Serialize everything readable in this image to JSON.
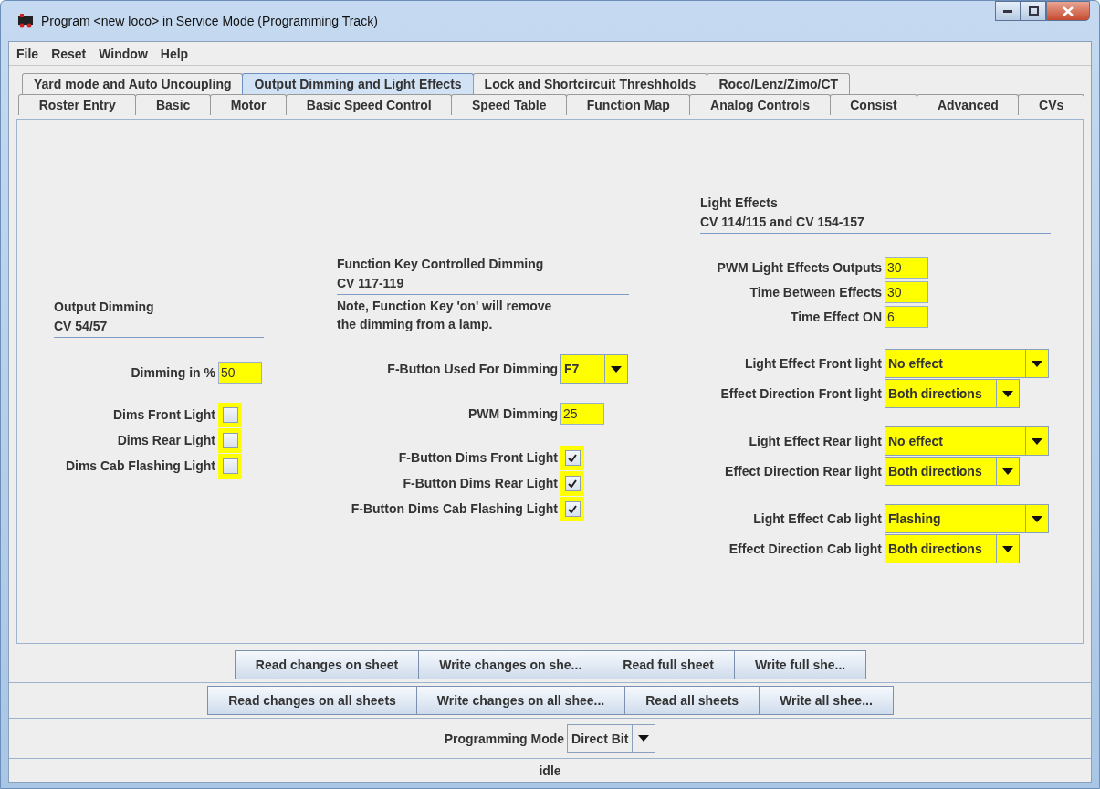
{
  "window": {
    "title": "Program <new loco> in Service Mode (Programming Track)"
  },
  "menu": [
    "File",
    "Reset",
    "Window",
    "Help"
  ],
  "tab_rows": [
    [
      {
        "label": "Yard mode and Auto Uncoupling",
        "selected": false
      },
      {
        "label": "Output Dimming and Light Effects",
        "selected": true
      },
      {
        "label": "Lock and Shortcircuit Threshholds",
        "selected": false
      },
      {
        "label": "Roco/Lenz/Zimo/CT",
        "selected": false
      }
    ],
    [
      {
        "label": "Roster Entry",
        "selected": false
      },
      {
        "label": "Basic",
        "selected": false
      },
      {
        "label": "Motor",
        "selected": false
      },
      {
        "label": "Basic Speed Control",
        "selected": false
      },
      {
        "label": "Speed Table",
        "selected": false
      },
      {
        "label": "Function Map",
        "selected": false
      },
      {
        "label": "Analog Controls",
        "selected": false
      },
      {
        "label": "Consist",
        "selected": false
      },
      {
        "label": "Advanced",
        "selected": false
      },
      {
        "label": "CVs",
        "selected": false
      }
    ]
  ],
  "sections": [
    {
      "title": "Output Dimming",
      "subtitle": "CV 54/57",
      "groups": [
        [
          {
            "kind": "field",
            "label": "Dimming in %",
            "value": "50"
          }
        ],
        [
          {
            "kind": "checkbox",
            "label": "Dims Front Light",
            "checked": false
          },
          {
            "kind": "checkbox",
            "label": "Dims Rear Light",
            "checked": false
          },
          {
            "kind": "checkbox",
            "label": "Dims Cab Flashing Light",
            "checked": false
          }
        ]
      ]
    },
    {
      "title": "Function Key Controlled Dimming",
      "subtitle": "CV 117-119",
      "note": [
        "Note, Function Key 'on' will remove",
        "the dimming from a lamp."
      ],
      "groups": [
        [
          {
            "kind": "dropdown",
            "label": "F-Button Used For Dimming",
            "value": "F7"
          }
        ],
        [
          {
            "kind": "field",
            "label": "PWM Dimming",
            "value": "25"
          }
        ],
        [
          {
            "kind": "checkbox",
            "label": "F-Button Dims Front Light",
            "checked": true
          },
          {
            "kind": "checkbox",
            "label": "F-Button Dims Rear Light",
            "checked": true
          },
          {
            "kind": "checkbox",
            "label": "F-Button Dims Cab Flashing Light",
            "checked": true
          }
        ]
      ]
    },
    {
      "title": "Light Effects",
      "subtitle": "CV 114/115 and CV 154-157",
      "groups": [
        [
          {
            "kind": "field",
            "label": "PWM Light Effects Outputs",
            "value": "30"
          },
          {
            "kind": "field",
            "label": "Time Between Effects",
            "value": "30"
          },
          {
            "kind": "field",
            "label": "Time Effect ON",
            "value": "6"
          }
        ],
        [
          {
            "kind": "dropdown",
            "label": "Light Effect Front light",
            "value": "No effect"
          },
          {
            "kind": "dropdown",
            "label": "Effect Direction Front light",
            "value": "Both directions"
          }
        ],
        [
          {
            "kind": "dropdown",
            "label": "Light Effect Rear light",
            "value": "No effect"
          },
          {
            "kind": "dropdown",
            "label": "Effect Direction Rear light",
            "value": "Both directions"
          }
        ],
        [
          {
            "kind": "dropdown",
            "label": "Light Effect Cab light",
            "value": "Flashing"
          },
          {
            "kind": "dropdown",
            "label": "Effect Direction Cab light",
            "value": "Both directions"
          }
        ]
      ]
    }
  ],
  "sheet_buttons": [
    "Read changes on sheet",
    "Write changes on she...",
    "Read full sheet",
    "Write full she..."
  ],
  "all_buttons": [
    "Read changes on all sheets",
    "Write changes on all shee...",
    "Read all sheets",
    "Write all shee..."
  ],
  "programming_mode": {
    "label": "Programming Mode",
    "value": "Direct Bit"
  },
  "status": "idle"
}
